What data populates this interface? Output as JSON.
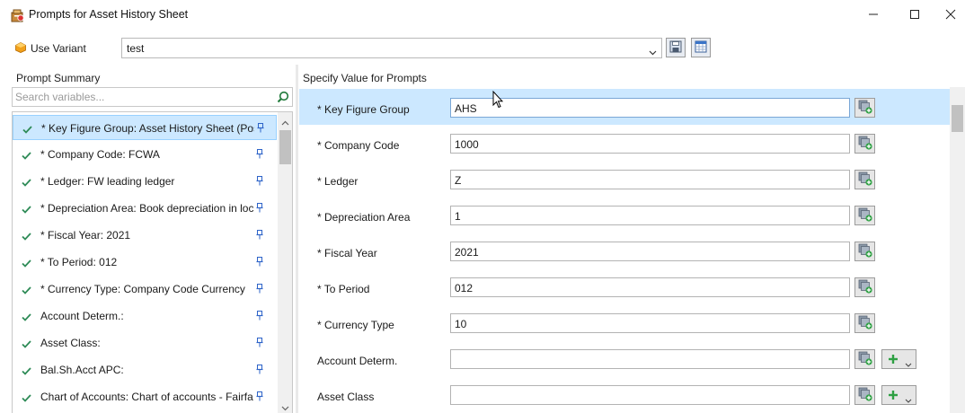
{
  "window": {
    "title": "Prompts for Asset History Sheet",
    "icon": "asset-history-icon",
    "controls": [
      "minimize-icon",
      "maximize-icon",
      "close-icon"
    ]
  },
  "variant": {
    "label": "Use Variant",
    "value": "test",
    "buttons": [
      "save-variant-icon",
      "manage-variants-icon"
    ]
  },
  "summary": {
    "title": "Prompt Summary",
    "search_placeholder": "Search variables...",
    "items": [
      {
        "label": "* Key Figure Group: Asset History Sheet (Post",
        "selected": true
      },
      {
        "label": "* Company Code: FCWA"
      },
      {
        "label": "* Ledger: FW leading ledger"
      },
      {
        "label": "* Depreciation Area: Book depreciation in loc"
      },
      {
        "label": "* Fiscal Year: 2021"
      },
      {
        "label": "* To Period: 012"
      },
      {
        "label": "* Currency Type: Company Code Currency"
      },
      {
        "label": "Account Determ.:"
      },
      {
        "label": "Asset Class:"
      },
      {
        "label": "Bal.Sh.Acct APC:"
      },
      {
        "label": "Chart of Accounts: Chart of accounts - Fairfax"
      }
    ]
  },
  "values": {
    "title": "Specify Value for Prompts",
    "rows": [
      {
        "label": "* Key Figure Group",
        "value": "AHS",
        "selected": true
      },
      {
        "label": "* Company Code",
        "value": "1000"
      },
      {
        "label": "* Ledger",
        "value": "Z"
      },
      {
        "label": "* Depreciation Area",
        "value": "1"
      },
      {
        "label": "* Fiscal Year",
        "value": "2021"
      },
      {
        "label": "* To Period",
        "value": "012"
      },
      {
        "label": "* Currency Type",
        "value": "10"
      },
      {
        "label": "Account Determ.",
        "value": "",
        "has_add": true
      },
      {
        "label": "Asset Class",
        "value": "",
        "has_add": true
      }
    ]
  },
  "colors": {
    "selection_bg": "#cce8ff",
    "selection_border": "#99d1ff",
    "check_green": "#2e8b57",
    "pin_blue": "#2d63c8"
  }
}
